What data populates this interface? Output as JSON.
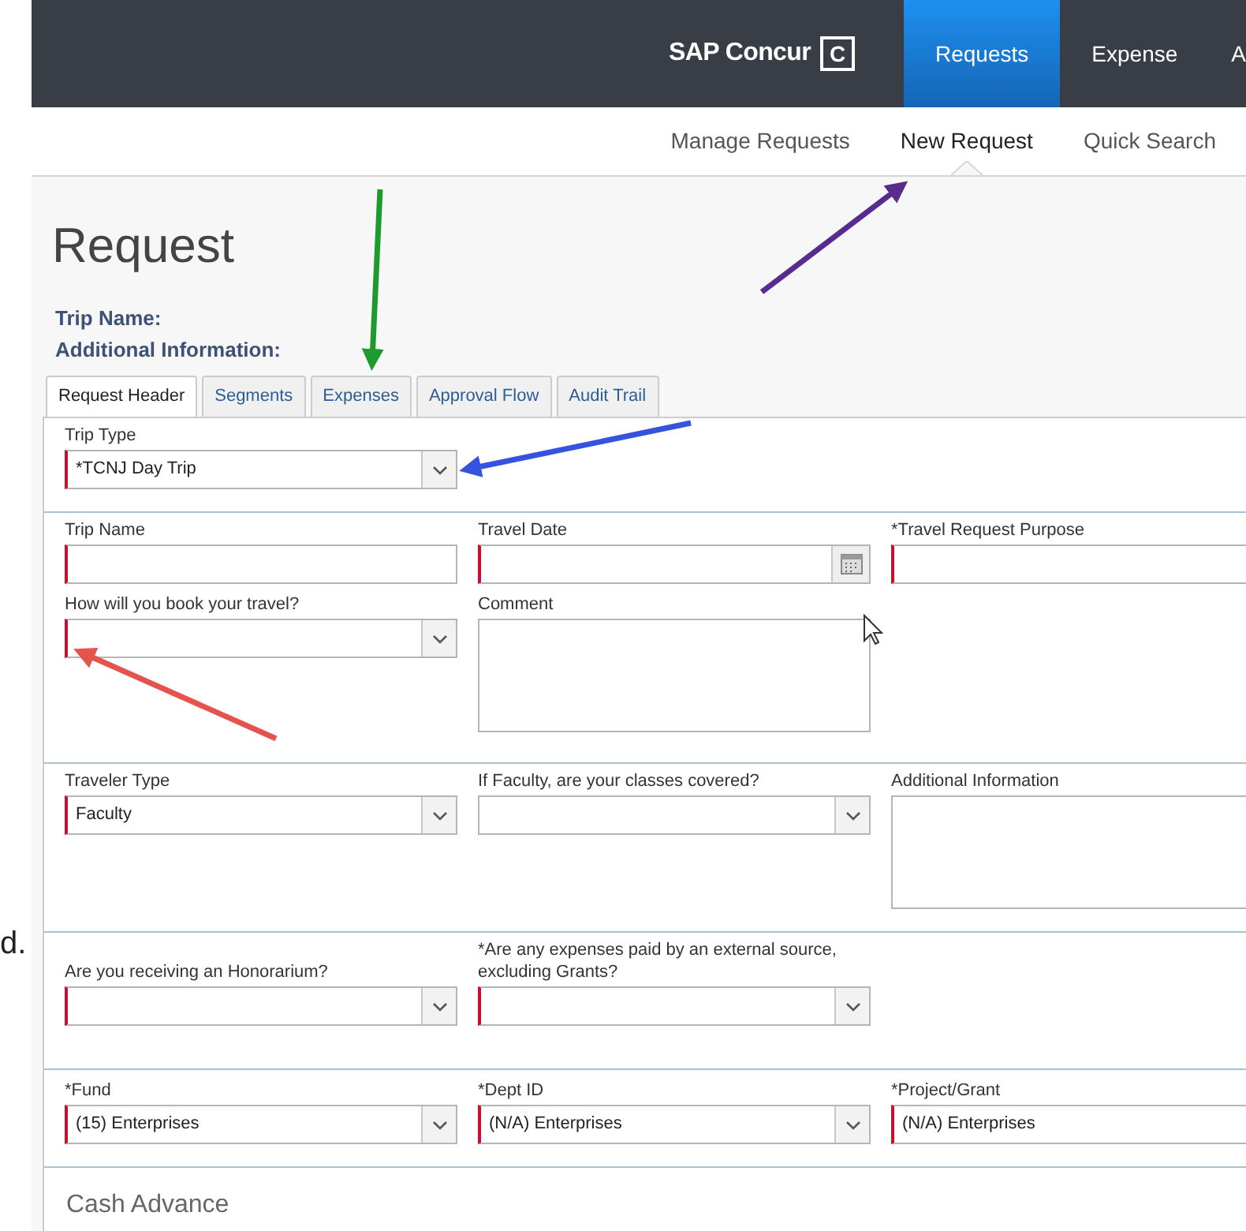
{
  "margin_text": "d.",
  "header": {
    "logo": "SAP Concur",
    "logo_mark": "C"
  },
  "nav": [
    {
      "label": "Requests",
      "selected": true
    },
    {
      "label": "Expense",
      "selected": false
    },
    {
      "label": "A",
      "selected": false
    }
  ],
  "subnav": [
    {
      "label": "Manage Requests",
      "selected": false
    },
    {
      "label": "New Request",
      "selected": true
    },
    {
      "label": "Quick Search",
      "selected": false
    }
  ],
  "page_title": "Request",
  "summary": [
    "Trip Name:",
    "Additional Information:"
  ],
  "tabs": [
    {
      "label": "Request Header",
      "selected": true
    },
    {
      "label": "Segments",
      "selected": false
    },
    {
      "label": "Expenses",
      "selected": false
    },
    {
      "label": "Approval Flow",
      "selected": false
    },
    {
      "label": "Audit Trail",
      "selected": false
    }
  ],
  "sections": [
    {
      "rows": [
        [
          {
            "label": "Trip Type",
            "kind": "select",
            "value": "*TCNJ Day Trip",
            "required": true
          }
        ]
      ]
    },
    {
      "rows": [
        [
          {
            "label": "Trip Name",
            "kind": "text",
            "required": true
          },
          {
            "label": "Travel Date",
            "kind": "date",
            "required": true
          },
          {
            "label": "*Travel Request Purpose",
            "kind": "text",
            "required": true
          }
        ],
        [
          {
            "label": "How will you book your travel?",
            "kind": "select",
            "required": true
          },
          {
            "label": "Comment",
            "kind": "textarea",
            "required": false
          }
        ]
      ]
    },
    {
      "rows": [
        [
          {
            "label": "Traveler Type",
            "kind": "select",
            "value": "Faculty",
            "required": true
          },
          {
            "label": "If Faculty, are your classes covered?",
            "kind": "select",
            "required": false
          },
          {
            "label": "Additional Information",
            "kind": "textarea",
            "required": false
          }
        ]
      ]
    },
    {
      "rows": [
        [
          {
            "label": "Are you receiving an Honorarium?",
            "kind": "select",
            "required": true
          },
          {
            "label": "*Are any expenses paid by an external source, excluding Grants?",
            "kind": "select",
            "required": true
          }
        ]
      ]
    },
    {
      "rows": [
        [
          {
            "label": "*Fund",
            "kind": "select",
            "value": "(15) Enterprises",
            "required": true
          },
          {
            "label": "*Dept ID",
            "kind": "select",
            "value": "(N/A) Enterprises",
            "required": true
          },
          {
            "label": "*Project/Grant",
            "kind": "select",
            "value": "(N/A) Enterprises",
            "required": true
          }
        ]
      ]
    }
  ],
  "next_section_title": "Cash Advance"
}
